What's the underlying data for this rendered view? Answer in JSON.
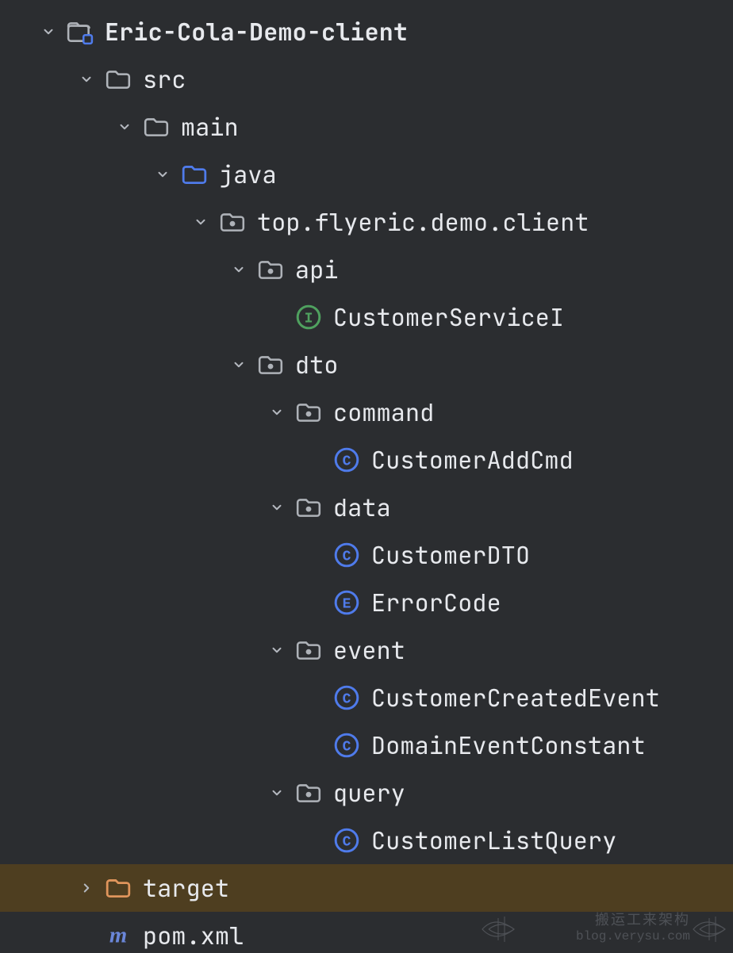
{
  "colors": {
    "background": "#2B2D30",
    "java_folder": "#4F7BEB",
    "target_folder": "#E0955C",
    "interface": "#4FA15F",
    "class": "#4F7BEB",
    "enum": "#4F7BEB",
    "maven": "#6A86D9",
    "selected_bg": "#4E3E20"
  },
  "tree": {
    "root": {
      "label": "Eric-Cola-Demo-client",
      "type": "module",
      "expanded": true,
      "children": {
        "src": {
          "label": "src",
          "type": "folder",
          "expanded": true,
          "children": {
            "main": {
              "label": "main",
              "type": "folder",
              "expanded": true,
              "children": {
                "java": {
                  "label": "java",
                  "type": "source-root",
                  "expanded": true,
                  "children": {
                    "pkg": {
                      "label": "top.flyeric.demo.client",
                      "type": "package",
                      "expanded": true,
                      "children": {
                        "api": {
                          "label": "api",
                          "type": "package",
                          "expanded": true,
                          "children": {
                            "CustomerServiceI": {
                              "label": "CustomerServiceI",
                              "type": "interface"
                            }
                          }
                        },
                        "dto": {
                          "label": "dto",
                          "type": "package",
                          "expanded": true,
                          "children": {
                            "command": {
                              "label": "command",
                              "type": "package",
                              "expanded": true,
                              "children": {
                                "CustomerAddCmd": {
                                  "label": "CustomerAddCmd",
                                  "type": "class"
                                }
                              }
                            },
                            "data": {
                              "label": "data",
                              "type": "package",
                              "expanded": true,
                              "children": {
                                "CustomerDTO": {
                                  "label": "CustomerDTO",
                                  "type": "class"
                                },
                                "ErrorCode": {
                                  "label": "ErrorCode",
                                  "type": "enum"
                                }
                              }
                            },
                            "event": {
                              "label": "event",
                              "type": "package",
                              "expanded": true,
                              "children": {
                                "CustomerCreatedEvent": {
                                  "label": "CustomerCreatedEvent",
                                  "type": "class"
                                },
                                "DomainEventConstant": {
                                  "label": "DomainEventConstant",
                                  "type": "class"
                                }
                              }
                            },
                            "query": {
                              "label": "query",
                              "type": "package",
                              "expanded": true,
                              "children": {
                                "CustomerListQuery": {
                                  "label": "CustomerListQuery",
                                  "type": "class"
                                }
                              }
                            }
                          }
                        }
                      }
                    }
                  }
                }
              }
            }
          }
        },
        "target": {
          "label": "target",
          "type": "excluded-folder",
          "expanded": false,
          "selected": true
        },
        "pom": {
          "label": "pom.xml",
          "type": "maven-file"
        }
      }
    }
  },
  "watermark": {
    "title": "搬运工来架构",
    "subtitle": "blog.verysu.com"
  }
}
